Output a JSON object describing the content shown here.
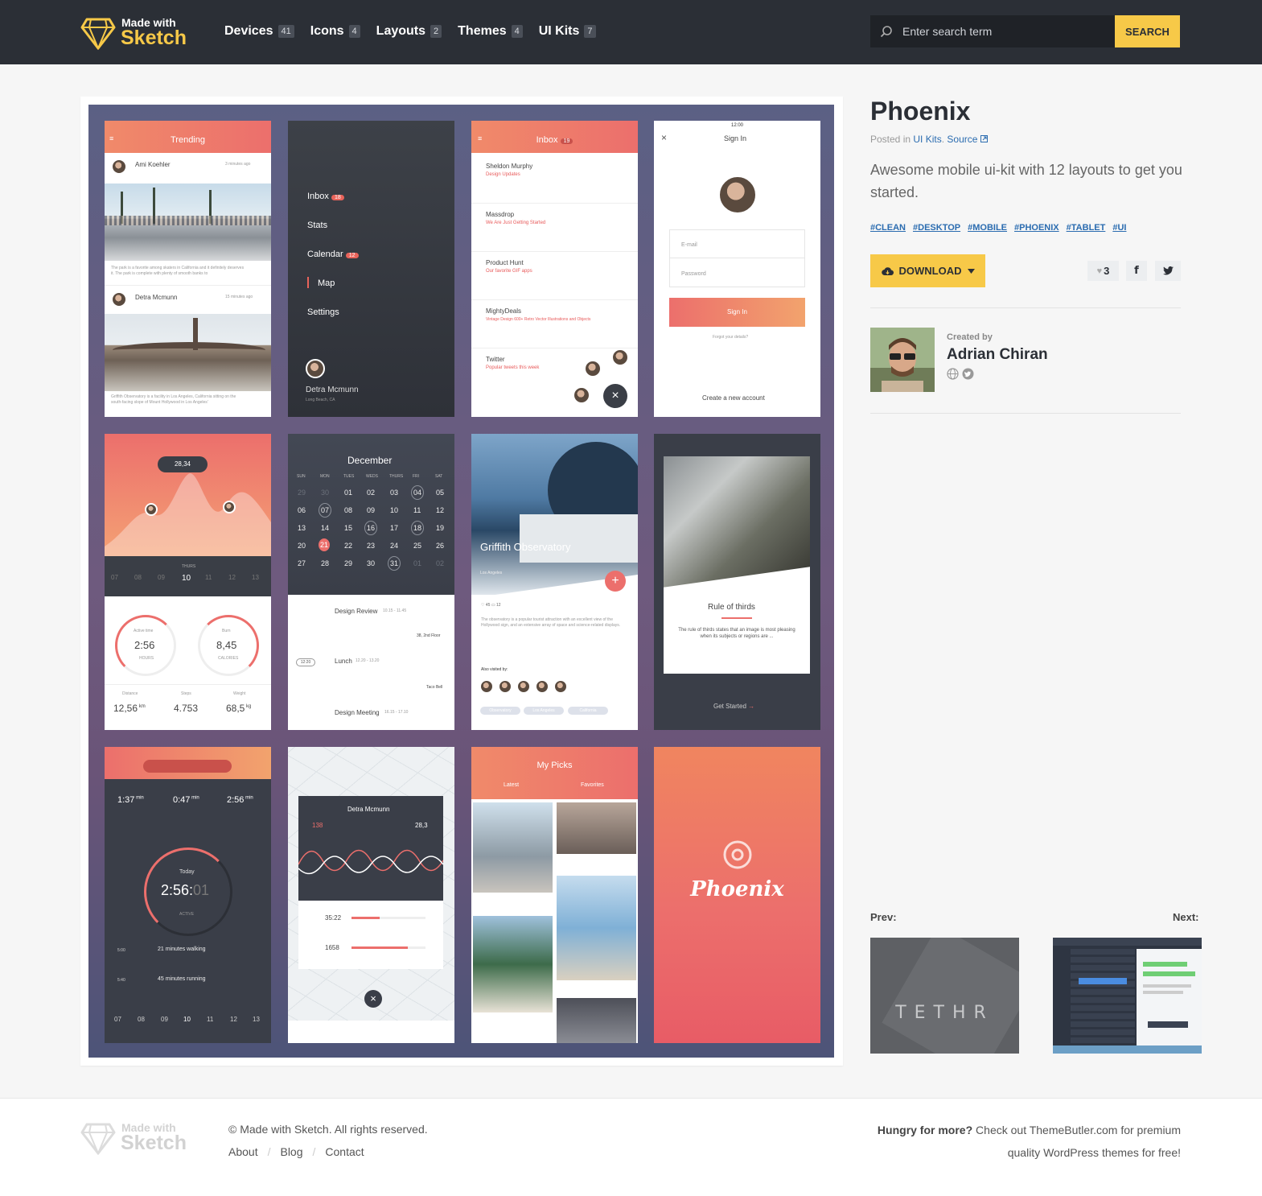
{
  "header": {
    "logo_small": "Made with",
    "logo_big": "Sketch",
    "nav": [
      {
        "label": "Devices",
        "count": "41"
      },
      {
        "label": "Icons",
        "count": "4"
      },
      {
        "label": "Layouts",
        "count": "2"
      },
      {
        "label": "Themes",
        "count": "4"
      },
      {
        "label": "UI Kits",
        "count": "7"
      }
    ],
    "search_placeholder": "Enter search term",
    "search_button": "SEARCH"
  },
  "colors": {
    "accent": "#f7c948",
    "dark": "#2b2f36",
    "link": "#2b6cb0",
    "coral": "#ec6f6c"
  },
  "preview": {
    "s1": {
      "title": "Trending",
      "user1": "Ami Koehler",
      "time1": "3 minutes ago",
      "text1": "The park is a favorite among skaters in California and it definitely deserves it. The park is complete with plenty of smooth banks to",
      "user2": "Detra Mcmunn",
      "time2": "15 minutes ago",
      "text2": "Griffith Observatory is a facility in Los Angeles, California sitting on the south-facing slope of Mount Hollywood in Los Angeles'"
    },
    "s2": {
      "items": [
        {
          "label": "Inbox",
          "badge": "18"
        },
        {
          "label": "Stats",
          "badge": ""
        },
        {
          "label": "Calendar",
          "badge": "12"
        },
        {
          "label": "Map",
          "badge": ""
        },
        {
          "label": "Settings",
          "badge": ""
        }
      ],
      "user": "Detra Mcmunn",
      "location": "Long Beach, CA"
    },
    "s3": {
      "title": "Inbox",
      "badge": "19",
      "mails": [
        {
          "from": "Sheldon Murphy",
          "subject": "Design Updates"
        },
        {
          "from": "Massdrop",
          "subject": "We Are Just Getting Started"
        },
        {
          "from": "Product Hunt",
          "subject": "Our favorite GIF apps"
        },
        {
          "from": "MightyDeals",
          "subject": "Vintage Design 600+ Retro Vector Illustrations and Objects"
        },
        {
          "from": "Twitter",
          "subject": "Popular tweets this week"
        }
      ]
    },
    "s4": {
      "title": "Sign In",
      "email": "E-mail",
      "password": "Password",
      "button": "Sign In",
      "forgot": "Forgot your details?",
      "create": "Create a new account"
    },
    "s5": {
      "bubble": "28,34",
      "days": [
        "07",
        "08",
        "09",
        "10",
        "11",
        "12",
        "13"
      ],
      "day_label": "THURS",
      "g1_label": "Active time",
      "g1_value": "2:56",
      "g1_unit": "HOURS",
      "g2_label": "Burn",
      "g2_value": "8,45",
      "g2_unit": "CALORIES",
      "stats": [
        {
          "label": "Distance",
          "value": "12,56",
          "unit": "km"
        },
        {
          "label": "Steps",
          "value": "4.753",
          "unit": ""
        },
        {
          "label": "Weight",
          "value": "68,5",
          "unit": "kg"
        }
      ]
    },
    "s6": {
      "month": "December",
      "weekdays": [
        "SUN",
        "MON",
        "TUES",
        "WEDS",
        "THURS",
        "FRI",
        "SAT"
      ],
      "rows": [
        [
          "29",
          "30",
          "01",
          "02",
          "03",
          "04",
          "05"
        ],
        [
          "06",
          "07",
          "08",
          "09",
          "10",
          "11",
          "12"
        ],
        [
          "13",
          "14",
          "15",
          "16",
          "17",
          "18",
          "19"
        ],
        [
          "20",
          "21",
          "22",
          "23",
          "24",
          "25",
          "26"
        ],
        [
          "27",
          "28",
          "29",
          "30",
          "31",
          "01",
          "02"
        ]
      ],
      "events": [
        {
          "title": "Design Review",
          "time": "10.15 - 11.45",
          "loc": "38, 2nd Floor"
        },
        {
          "title": "Lunch",
          "time": "12.20 - 13.20",
          "loc": "Taco Bell"
        },
        {
          "title": "Design Meeting",
          "time": "16.15 - 17.10",
          "loc": ""
        }
      ],
      "pill": "12:20"
    },
    "s7": {
      "title": "Griffith Observatory",
      "sub": "Los Angeles",
      "likes": "45",
      "comments": "12",
      "text": "The observatory is a popular tourist attraction with an excellent view of the Hollywood sign, and an extensive array of space and science-related displays.",
      "visited": "Also visited by:",
      "tags": [
        "Observatory",
        "Los Angeles",
        "California"
      ]
    },
    "s8": {
      "title": "Rule of thirds",
      "text": "The rule of thirds states that an image is most pleasing when its subjects or regions are ...",
      "cta": "Get Started"
    },
    "s9": {
      "times": [
        {
          "value": "1:37",
          "unit": "min",
          "label": "Walking"
        },
        {
          "value": "0:47",
          "unit": "min",
          "label": "Running"
        },
        {
          "value": "2:56",
          "unit": "min",
          "label": "Cycling"
        }
      ],
      "today": "Today",
      "big": "2:56:",
      "big_dim": "01",
      "active": "ACTIVE",
      "entries": [
        "21 minutes walking",
        "45 minutes running"
      ],
      "e_times": [
        "5:00",
        "5:40"
      ],
      "days": [
        "07",
        "08",
        "09",
        "10",
        "11",
        "12",
        "13"
      ]
    },
    "s10": {
      "name": "Detra Mcmunn",
      "left": "138",
      "right": "28,3",
      "r1": "35:22",
      "r2": "1658"
    },
    "s11": {
      "title": "My Picks",
      "tab1": "Latest",
      "tab2": "Favorites"
    },
    "s12": {
      "brand": "Phoenix"
    }
  },
  "detail": {
    "title": "Phoenix",
    "posted_prefix": "Posted in",
    "category": "UI Kits",
    "source": "Source",
    "description": "Awesome mobile ui-kit with 12 layouts to get you started.",
    "tags": [
      "#CLEAN",
      "#DESKTOP",
      "#MOBILE",
      "#PHOENIX",
      "#TABLET",
      "#UI"
    ],
    "download": "DOWNLOAD",
    "likes": "3",
    "created_by": "Created by",
    "author": "Adrian Chiran",
    "prev": "Prev:",
    "next": "Next:",
    "prev_text": "TETHR"
  },
  "footer": {
    "logo_small": "Made with",
    "logo_big": "Sketch",
    "copyright": "© Made with Sketch. All rights reserved.",
    "links": [
      "About",
      "Blog",
      "Contact"
    ],
    "promo_bold": "Hungry for more?",
    "promo_text": "Check out ThemeButler.com for premium",
    "promo_text2": "quality WordPress themes for free!"
  }
}
